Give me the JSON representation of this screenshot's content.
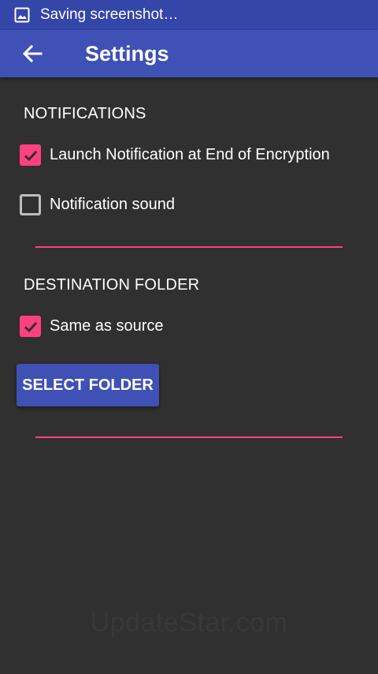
{
  "status_bar": {
    "text": "Saving screenshot…",
    "icon": "image-icon"
  },
  "app_bar": {
    "back_icon": "arrow-back-icon",
    "title": "Settings"
  },
  "notifications": {
    "header": "NOTIFICATIONS",
    "items": [
      {
        "label": "Launch Notification at End of Encryption",
        "checked": true
      },
      {
        "label": "Notification sound",
        "checked": false
      }
    ]
  },
  "destination": {
    "header": "DESTINATION FOLDER",
    "same_as_source": {
      "label": "Same as source",
      "checked": true
    },
    "select_button": "SELECT FOLDER"
  },
  "watermark": "UpdateStar.com",
  "colors": {
    "status_bar": "#3446a8",
    "app_bar": "#3f51b5",
    "accent": "#ff4081",
    "background": "#303030"
  }
}
